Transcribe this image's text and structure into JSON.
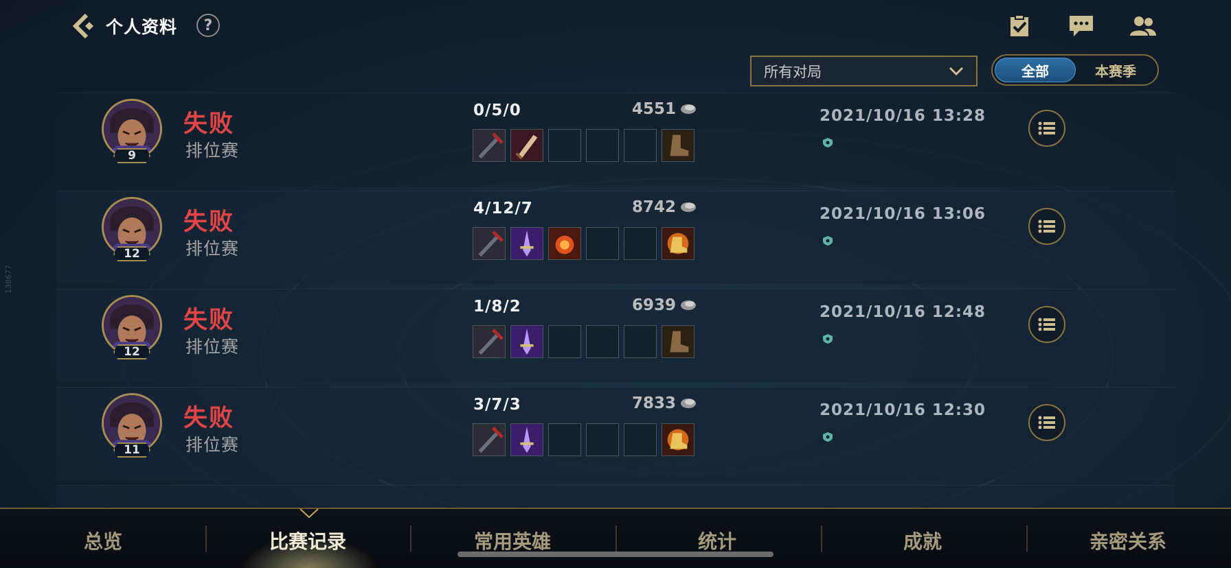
{
  "header": {
    "title": "个人资料",
    "help": "?",
    "icons": [
      "back-icon",
      "checklist-icon",
      "chat-icon",
      "friends-icon"
    ]
  },
  "filters": {
    "dropdown_value": "所有对局",
    "segments": [
      {
        "label": "全部",
        "active": true
      },
      {
        "label": "本赛季",
        "active": false
      }
    ]
  },
  "matches": [
    {
      "result": "失败",
      "mode": "排位赛",
      "level": "9",
      "kda": "0/5/0",
      "gold": "4551",
      "date": "2021/10/16 13:28",
      "items": [
        "dark-sword",
        "dagger",
        "empty",
        "empty",
        "empty",
        "boots"
      ]
    },
    {
      "result": "失败",
      "mode": "排位赛",
      "level": "12",
      "kda": "4/12/7",
      "gold": "8742",
      "date": "2021/10/16 13:06",
      "items": [
        "dark-sword",
        "purple-blade",
        "fire-orb",
        "empty",
        "empty",
        "golden-boots"
      ]
    },
    {
      "result": "失败",
      "mode": "排位赛",
      "level": "12",
      "kda": "1/8/2",
      "gold": "6939",
      "date": "2021/10/16 12:48",
      "items": [
        "dark-sword",
        "purple-blade",
        "empty",
        "empty",
        "empty",
        "boots"
      ]
    },
    {
      "result": "失败",
      "mode": "排位赛",
      "level": "11",
      "kda": "3/7/3",
      "gold": "7833",
      "date": "2021/10/16 12:30",
      "items": [
        "dark-sword",
        "purple-blade",
        "empty",
        "empty",
        "empty",
        "golden-boots"
      ]
    }
  ],
  "bottom_nav": [
    {
      "label": "总览",
      "active": false
    },
    {
      "label": "比赛记录",
      "active": true
    },
    {
      "label": "常用英雄",
      "active": false
    },
    {
      "label": "统计",
      "active": false
    },
    {
      "label": "成就",
      "active": false
    },
    {
      "label": "亲密关系",
      "active": false
    }
  ],
  "side_tag": "138677",
  "colors": {
    "loss": "#e24545",
    "gold_accent": "#cdbe91",
    "active_tab": "#2e6fa4"
  }
}
